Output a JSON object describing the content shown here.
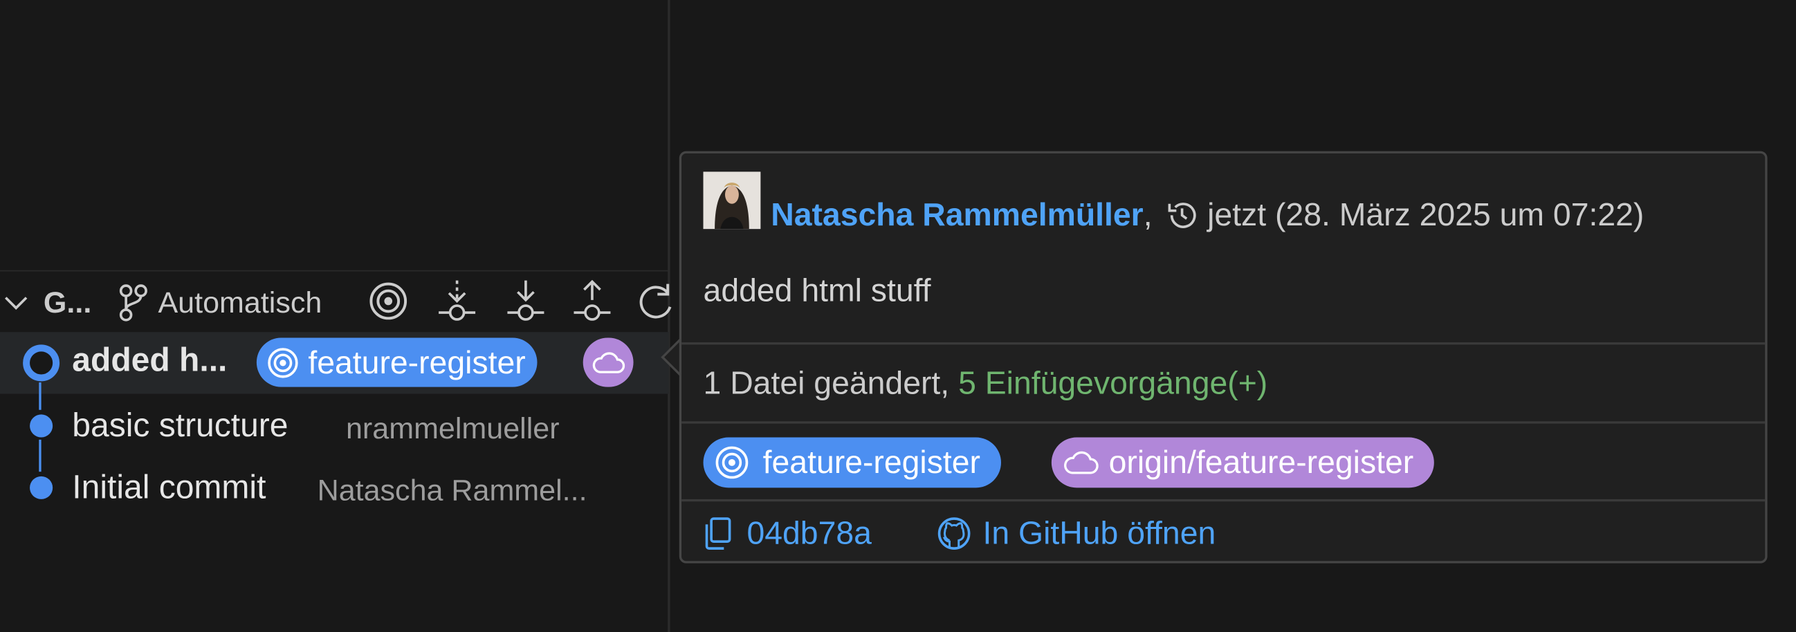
{
  "panel": {
    "title": "G...",
    "mode_label": "Automatisch"
  },
  "commits": [
    {
      "title": "added h...",
      "branch": "feature-register"
    },
    {
      "title": "basic structure",
      "author": "nrammelmueller"
    },
    {
      "title": "Initial commit",
      "author": "Natascha Rammel..."
    }
  ],
  "hover": {
    "author": "Natascha Rammelmüller",
    "separator": ",",
    "time": "jetzt (28. März 2025 um 07:22)",
    "message": "added html stuff",
    "stats_files": "1 Datei geändert, ",
    "stats_insertions": "5 Einfügevorgänge(+)",
    "local_branch": "feature-register",
    "remote_branch": "origin/feature-register",
    "sha": "04db78a",
    "open_github": "In GitHub öffnen"
  },
  "colors": {
    "background": "#181818",
    "hover_background": "#202020",
    "accent_blue": "#4c8ff1",
    "link_blue": "#4fa3f7",
    "remote_purple": "#b187d9",
    "insertions_green": "#6fb56f",
    "graph_line": "#4a8ff0"
  },
  "icons": [
    "chevron-down-icon",
    "git-branch-icon",
    "target-icon",
    "fetch-icon",
    "pull-icon",
    "push-icon",
    "refresh-icon",
    "cloud-icon",
    "history-icon",
    "copy-icon",
    "github-icon"
  ]
}
